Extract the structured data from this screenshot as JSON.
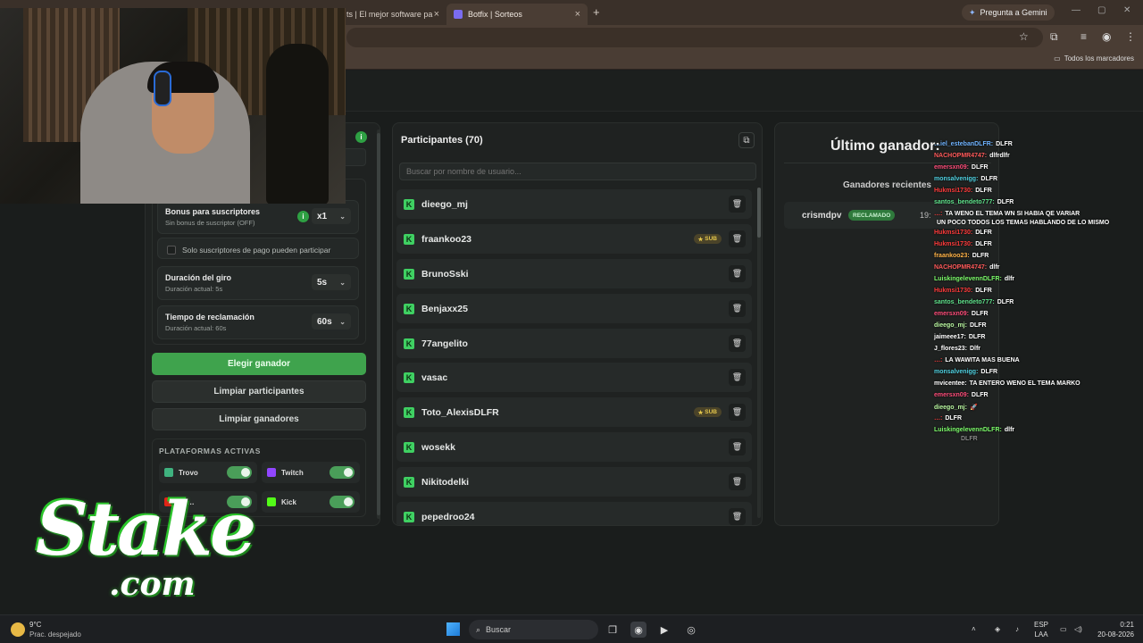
{
  "browser": {
    "tabs": [
      {
        "label": "ts | El mejor software pa"
      },
      {
        "label": "Botfix | Sorteos",
        "active": true
      }
    ],
    "gemini_button": "Pregunta a Gemini",
    "bookmarks_all": "Todos los marcadores"
  },
  "settings": {
    "bonus": {
      "title": "Bonus para suscriptores",
      "subtitle": "Sin bonus de suscriptor (OFF)",
      "value": "x1"
    },
    "paid_only_label": "Solo suscriptores de pago pueden participar",
    "spin": {
      "title": "Duración del giro",
      "subtitle": "Duración actual: 5s",
      "value": "5s"
    },
    "claim": {
      "title": "Tiempo de reclamación",
      "subtitle": "Duración actual: 60s",
      "value": "60s"
    }
  },
  "actions": {
    "pick_winner": "Elegir ganador",
    "clear_participants": "Limpiar participantes",
    "clear_winners": "Limpiar ganadores"
  },
  "platforms": {
    "title": "PLATAFORMAS ACTIVAS",
    "items": [
      {
        "name": "Trovo",
        "enabled": true,
        "color": "#3fb27f"
      },
      {
        "name": "Twitch",
        "enabled": true,
        "color": "#9146ff"
      },
      {
        "name": "Yo…",
        "enabled": true,
        "color": "#e62117"
      },
      {
        "name": "Kick",
        "enabled": true,
        "color": "#53fc18"
      }
    ]
  },
  "participants": {
    "title": "Participantes (70)",
    "search_placeholder": "Buscar por nombre de usuario...",
    "sub_label": "SUB",
    "rows": [
      {
        "name": "dieego_mj",
        "sub": false
      },
      {
        "name": "fraankoo23",
        "sub": true
      },
      {
        "name": "BrunoSski",
        "sub": false
      },
      {
        "name": "Benjaxx25",
        "sub": false
      },
      {
        "name": "77angelito",
        "sub": false
      },
      {
        "name": "vasac",
        "sub": false
      },
      {
        "name": "Toto_AlexisDLFR",
        "sub": true
      },
      {
        "name": "wosekk",
        "sub": false
      },
      {
        "name": "Nikitodelki",
        "sub": false
      },
      {
        "name": "pepedroo24",
        "sub": false
      }
    ]
  },
  "winner": {
    "title": "Último ganador:",
    "recent_title": "Ganadores recientes",
    "recent": [
      {
        "name": "crismdpv",
        "status": "RECLAMADO",
        "time": "19:"
      }
    ]
  },
  "chat": [
    {
      "user": "…iel_estebanDLFR:",
      "text": "DLFR",
      "color": "#6fb3ff"
    },
    {
      "user": "NACHOPMR4747:",
      "text": "dlfrdlfr",
      "color": "#ff5a5a"
    },
    {
      "user": "emersxn09:",
      "text": "DLFR",
      "color": "#ff4d7a"
    },
    {
      "user": "monsalvenigg:",
      "text": "DLFR",
      "color": "#4fd0e0"
    },
    {
      "user": "Hukmsi1730:",
      "text": "DLFR",
      "color": "#ff3b3b"
    },
    {
      "user": "santos_bendeto777:",
      "text": "DLFR",
      "color": "#5ee08a"
    },
    {
      "user": "…:",
      "text": "TA WENO EL TEMA WN SI HABIA QE VARIAR",
      "color": "#ff3b3b"
    },
    {
      "user": "",
      "text": "UN POCO TODOS LOS TEMAS HABLANDO DE LO MISMO",
      "color": "#ffffff"
    },
    {
      "user": "Hukmsi1730:",
      "text": "DLFR",
      "color": "#ff3b3b"
    },
    {
      "user": "Hukmsi1730:",
      "text": "DLFR",
      "color": "#ff3b3b"
    },
    {
      "user": "fraankoo23:",
      "text": "DLFR",
      "color": "#ffb347"
    },
    {
      "user": "NACHOPMR4747:",
      "text": "dlfr",
      "color": "#ff5a5a"
    },
    {
      "user": "LuiskingelevennDLFR:",
      "text": "dlfr",
      "color": "#7cfc6a"
    },
    {
      "user": "Hukmsi1730:",
      "text": "DLFR",
      "color": "#ff3b3b"
    },
    {
      "user": "santos_bendeto777:",
      "text": "DLFR",
      "color": "#5ee08a"
    },
    {
      "user": "emersxn09:",
      "text": "DLFR",
      "color": "#ff4d7a"
    },
    {
      "user": "dieego_mj:",
      "text": "DLFR",
      "color": "#b9f7a0"
    },
    {
      "user": "jaimeee17:",
      "text": "DLFR",
      "color": "#ffffff"
    },
    {
      "user": "J_flores23:",
      "text": "Dlfr",
      "color": "#ffffff"
    },
    {
      "user": "…:",
      "text": "LA WAWITA MAS BUENA",
      "color": "#ff3b3b"
    },
    {
      "user": "monsalvenigg:",
      "text": "DLFR",
      "color": "#4fd0e0"
    },
    {
      "user": "mvicentee:",
      "text": "TA ENTERO WENO EL TEMA MARKO",
      "color": "#ffffff"
    },
    {
      "user": "emersxn09:",
      "text": "DLFR",
      "color": "#ff4d7a"
    },
    {
      "user": "dieego_mj:",
      "text": "🚀",
      "color": "#b9f7a0"
    },
    {
      "user": "…:",
      "text": "DLFR",
      "color": "#ff3b3b"
    },
    {
      "user": "LuiskingelevennDLFR:",
      "text": "dlfr",
      "color": "#7cfc6a"
    },
    {
      "user": "",
      "text": "DLFR",
      "color": "#888888"
    }
  ],
  "stake": {
    "line1": "Stake",
    "line2": ".com"
  },
  "taskbar": {
    "weather_temp": "9°C",
    "weather_desc": "Prac. despejado",
    "search_label": "Buscar",
    "lang_top": "ESP",
    "lang_bottom": "LAA",
    "time": "0:21",
    "date": "20-08-2026"
  }
}
